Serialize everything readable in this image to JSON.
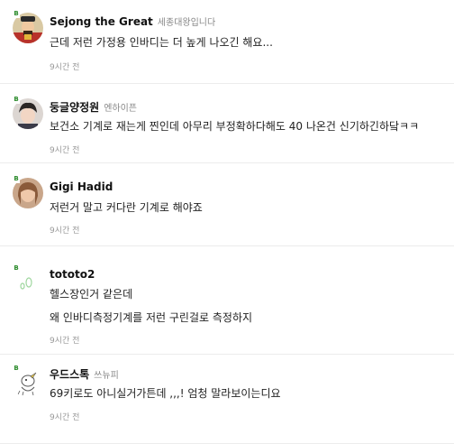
{
  "comments": [
    {
      "level": "B",
      "nickname": "Sejong the Great",
      "club": "세종대왕입니다",
      "lines": [
        "근데 저런 가정용 인바디는 더 높게 나오긴 해요..."
      ],
      "time": "9시간 전"
    },
    {
      "level": "B",
      "nickname": "둥글양정원",
      "club": "엔하이픈",
      "lines": [
        "보건소 기계로 재는게 찐인데 아무리 부정확하다해도 40 나온건 신기하긴하닼ㅋㅋ"
      ],
      "time": "9시간 전"
    },
    {
      "level": "B",
      "nickname": "Gigi Hadid",
      "club": "",
      "lines": [
        "저런거 말고 커다란 기계로 해야죠"
      ],
      "time": "9시간 전"
    },
    {
      "level": "B",
      "nickname": "tototo2",
      "club": "",
      "lines": [
        "헬스장인거 같은데",
        "왜 인바디측정기계를 저런 구린걸로 측정하지"
      ],
      "time": "9시간 전"
    },
    {
      "level": "B",
      "nickname": "우드스톡",
      "club": "쓰뉴피",
      "lines": [
        "69키로도 아니실거가튼데 ,,,! 엄청 말라보이는디요"
      ],
      "time": "9시간 전"
    }
  ],
  "colors": {
    "level_badge": "#2a8a2a",
    "nickname": "#111111",
    "club": "#888888",
    "time": "#999999",
    "divider": "#ececec"
  }
}
